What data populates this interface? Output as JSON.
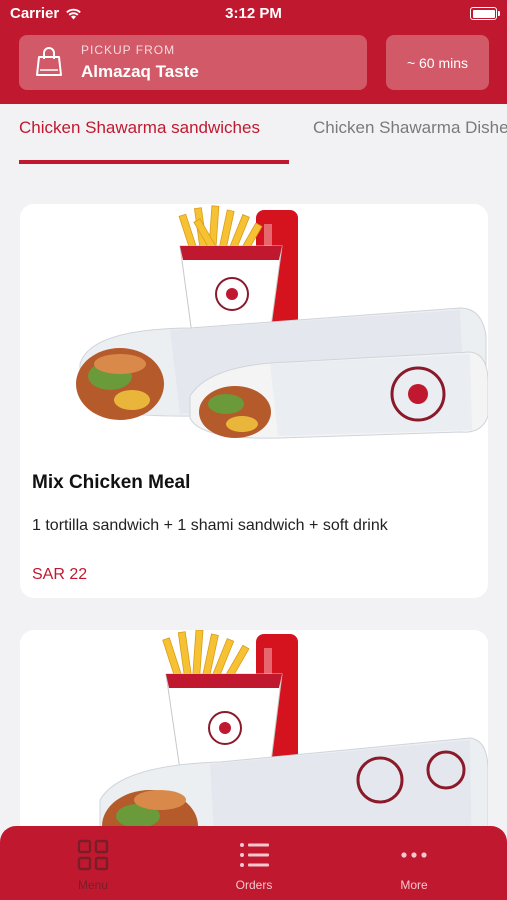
{
  "status_bar": {
    "carrier": "Carrier",
    "time": "3:12 PM"
  },
  "pickup": {
    "label": "PICKUP FROM",
    "name": "Almazaq Taste"
  },
  "eta": "~ 60 mins",
  "tabs": [
    {
      "label": "Chicken Shawarma sandwiches",
      "active": true
    },
    {
      "label": "Chicken Shawarma Dishes",
      "active": false
    }
  ],
  "products": [
    {
      "name": "Mix Chicken Meal",
      "description": "1 tortilla sandwich + 1 shami sandwich + soft drink",
      "price": "SAR 22"
    },
    {
      "name": "",
      "description": "",
      "price": ""
    }
  ],
  "bottom_nav": [
    {
      "label": "Menu",
      "icon": "grid-icon",
      "active": true
    },
    {
      "label": "Orders",
      "icon": "list-icon",
      "active": false
    },
    {
      "label": "More",
      "icon": "more-dots-icon",
      "active": false
    }
  ],
  "colors": {
    "brand": "#c0192f",
    "background": "#f2f2f4",
    "price": "#c0192f"
  }
}
